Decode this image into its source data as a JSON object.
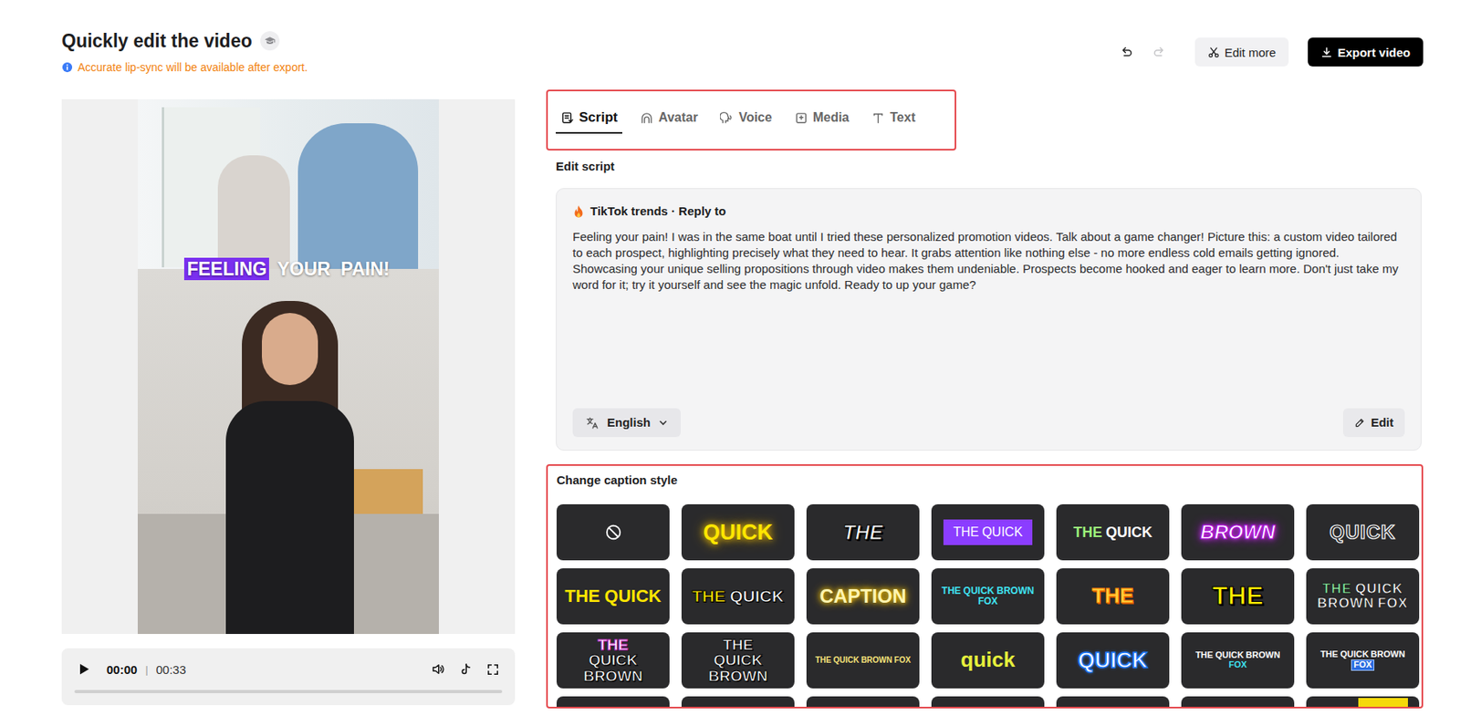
{
  "title": "Quickly edit the video",
  "notice": "Accurate lip-sync will be available after export.",
  "toolbar": {
    "history": [
      {
        "kind": "undo",
        "enabled": true
      },
      {
        "kind": "redo",
        "enabled": false
      }
    ],
    "buttons": [
      {
        "label": "Edit more",
        "kind": "secondary"
      },
      {
        "label": "Export video",
        "kind": "primary"
      }
    ]
  },
  "preview": {
    "caption": [
      {
        "text": "FEELING",
        "highlighted": true
      },
      {
        "text": "YOUR",
        "highlighted": false
      },
      {
        "text": "PAIN!",
        "highlighted": false
      }
    ]
  },
  "player": {
    "playing": false,
    "current": "00:00",
    "separator": "|",
    "duration": "00:33",
    "level": 0
  },
  "tabs": [
    {
      "label": "Script",
      "selected": true
    },
    {
      "label": "Avatar",
      "selected": false
    },
    {
      "label": "Voice",
      "selected": false
    },
    {
      "label": "Media",
      "selected": false
    },
    {
      "label": "Text",
      "selected": false
    }
  ],
  "script": {
    "heading": "Edit script",
    "tag": "TikTok trends · Reply to",
    "text": "Feeling your pain! I was in the same boat until I tried these personalized promotion videos. Talk about a game changer! Picture this: a custom video tailored to each prospect, highlighting precisely what they need to hear. It grabs attention like nothing else - no more endless cold emails getting ignored. Showcasing your unique selling propositions through video makes them undeniable. Prospects become hooked and eager to learn more. Don't just take my word for it; try it yourself and see the magic unfold. Ready to up your game?",
    "language": "English",
    "edit_label": "Edit"
  },
  "captions": {
    "heading": "Change caption style",
    "styles": [
      {
        "kind": "none",
        "words": [],
        "selected": false
      },
      {
        "kind": "glow-yellow",
        "words": [
          "QUICK"
        ],
        "selected": false
      },
      {
        "kind": "italic-outline",
        "words": [
          "THE"
        ],
        "selected": false
      },
      {
        "kind": "purple-box",
        "words": [
          "THE",
          "QUICK"
        ],
        "selected": false
      },
      {
        "kind": "green-first",
        "words": [
          "THE",
          "QUICK"
        ],
        "selected": false
      },
      {
        "kind": "pink-glow",
        "words": [
          "BROWN"
        ],
        "selected": false
      },
      {
        "kind": "outline",
        "words": [
          "QUICK"
        ],
        "selected": false
      },
      {
        "kind": "yellow-bold",
        "words": [
          "THE",
          "QUICK"
        ],
        "selected": false
      },
      {
        "kind": "yellow-white-stroke",
        "words": [
          "THE",
          "QUICK"
        ],
        "selected": false
      },
      {
        "kind": "caption-glow",
        "words": [
          "CAPTION"
        ],
        "selected": false
      },
      {
        "kind": "cyan-small",
        "words": [
          "THE",
          "QUICK",
          "BROWN",
          "FOX"
        ],
        "selected": false
      },
      {
        "kind": "orange-stroke",
        "words": [
          "THE"
        ],
        "selected": false
      },
      {
        "kind": "yellow-big",
        "words": [
          "THE"
        ],
        "selected": false
      },
      {
        "kind": "green-white-stack",
        "words": [
          "THE",
          "QUICK",
          "BROWN",
          "FOX"
        ],
        "selected": false
      },
      {
        "kind": "stack-pink",
        "words": [
          "THE",
          "QUICK",
          "BROWN"
        ],
        "selected": false
      },
      {
        "kind": "stack-white",
        "words": [
          "THE",
          "QUICK",
          "BROWN"
        ],
        "selected": false
      },
      {
        "kind": "tiny-yellow",
        "words": [
          "THE",
          "QUICK",
          "BROWN",
          "FOX"
        ],
        "selected": false
      },
      {
        "kind": "lower-yellow",
        "words": [
          "quick"
        ],
        "selected": false
      },
      {
        "kind": "blue-stroke",
        "words": [
          "QUICK"
        ],
        "selected": false
      },
      {
        "kind": "small-cyan-last",
        "words": [
          "THE",
          "QUICK",
          "BROWN",
          "FOX"
        ],
        "selected": false
      },
      {
        "kind": "box-last",
        "words": [
          "THE",
          "QUICK",
          "BROWN",
          "FOX"
        ],
        "selected": false
      },
      {
        "kind": "stub",
        "words": [],
        "selected": false
      },
      {
        "kind": "stub",
        "words": [],
        "selected": false
      },
      {
        "kind": "stub",
        "words": [],
        "selected": false
      },
      {
        "kind": "stub",
        "words": [],
        "selected": false
      },
      {
        "kind": "stub",
        "words": [],
        "selected": false
      },
      {
        "kind": "stub",
        "words": [],
        "selected": false
      },
      {
        "kind": "stub-yellow",
        "words": [],
        "selected": false
      }
    ]
  }
}
